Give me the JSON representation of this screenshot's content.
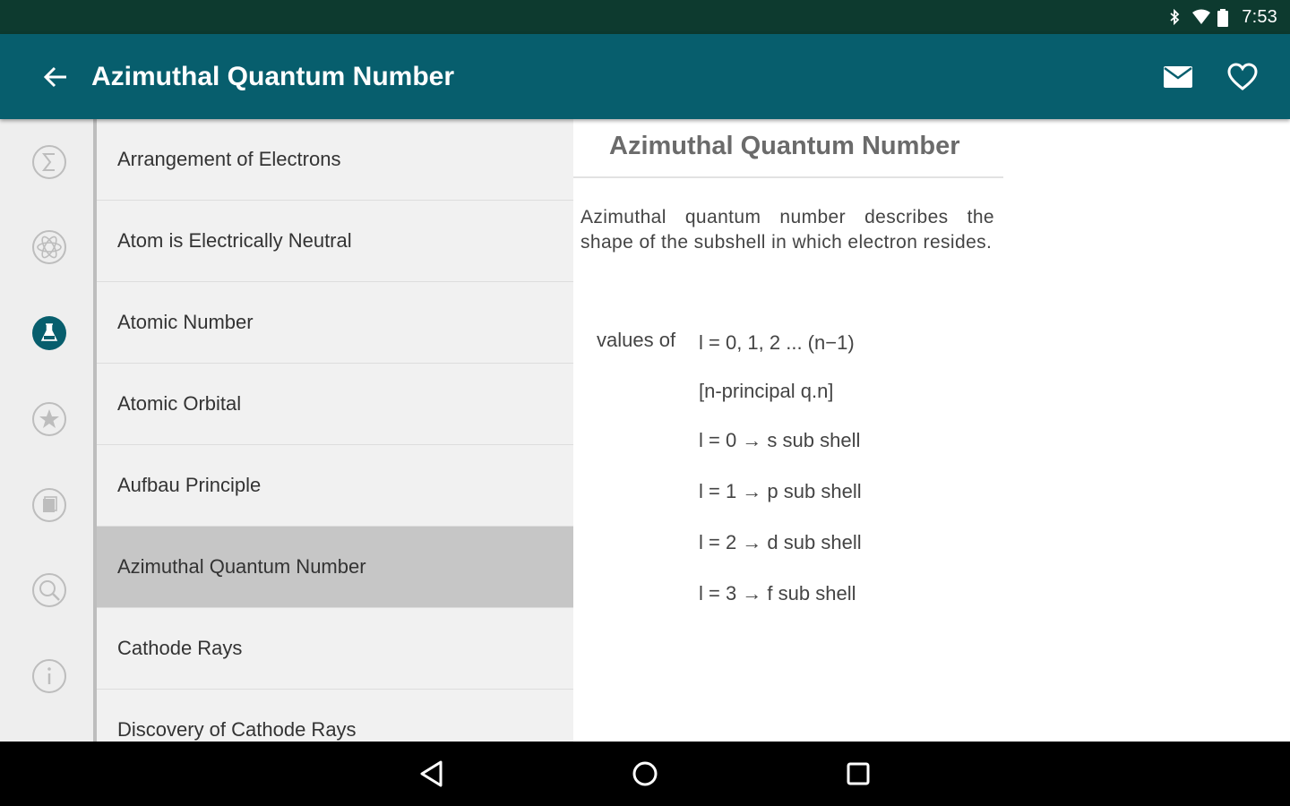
{
  "status_bar": {
    "time": "7:53",
    "icons": [
      "bluetooth-icon",
      "wifi-icon",
      "battery-icon"
    ]
  },
  "app_bar": {
    "title": "Azimuthal Quantum Number",
    "back_icon": "arrow-back-icon",
    "actions": [
      "email-icon",
      "favorite-icon"
    ]
  },
  "rail": {
    "items": [
      {
        "icon": "sigma-icon",
        "active": false
      },
      {
        "icon": "atom-icon",
        "active": false
      },
      {
        "icon": "flask-icon",
        "active": true
      },
      {
        "icon": "star-icon",
        "active": false
      },
      {
        "icon": "notes-icon",
        "active": false
      },
      {
        "icon": "search-icon",
        "active": false
      },
      {
        "icon": "info-icon",
        "active": false
      }
    ],
    "accent_color": "#075e6d"
  },
  "list": {
    "items": [
      {
        "label": "Arrangement of Electrons"
      },
      {
        "label": "Atom is Electrically Neutral"
      },
      {
        "label": "Atomic Number"
      },
      {
        "label": "Atomic Orbital"
      },
      {
        "label": "Aufbau Principle"
      },
      {
        "label": "Azimuthal Quantum Number",
        "selected": true
      },
      {
        "label": "Cathode Rays"
      },
      {
        "label": "Discovery of Cathode Rays"
      }
    ]
  },
  "detail": {
    "title": "Azimuthal Quantum Number",
    "description": "Azimuthal quantum number describes the shape of the subshell in which electron resides.",
    "values_label": "values of",
    "formulas": [
      "l = 0, 1, 2 ... (n−1)",
      "[n-principal q.n]",
      "l = 0 → s sub shell",
      "l = 1 → p sub shell",
      "l = 2 → d sub shell",
      "l = 3 → f sub shell"
    ]
  },
  "nav_bar": {
    "buttons": [
      "back-triangle-icon",
      "home-circle-icon",
      "recents-square-icon"
    ]
  },
  "colors": {
    "status_bar": "#0d3a2f",
    "app_bar": "#075e6d",
    "selected_row": "#c6c6c6"
  }
}
